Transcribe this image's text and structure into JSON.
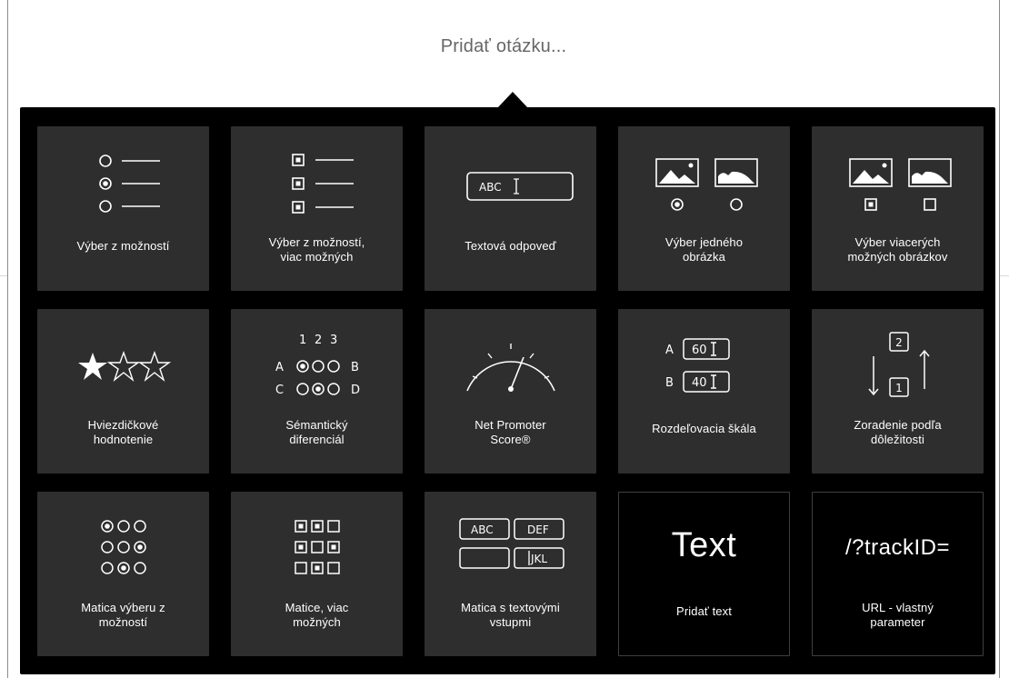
{
  "header": {
    "add_question_label": "Pridať otázku..."
  },
  "tiles": [
    {
      "id": "single-choice",
      "label_lines": [
        "Výber z možností"
      ],
      "icon": "radio-list-icon"
    },
    {
      "id": "multiple-choice",
      "label_lines": [
        "Výber z možností,",
        "viac možných"
      ],
      "icon": "checkbox-list-icon"
    },
    {
      "id": "text-answer",
      "label_lines": [
        "Textová odpoveď"
      ],
      "icon": "text-field-icon",
      "icon_text": "ABC"
    },
    {
      "id": "single-image",
      "label_lines": [
        "Výber jedného",
        "obrázka"
      ],
      "icon": "image-radio-icon"
    },
    {
      "id": "multiple-image",
      "label_lines": [
        "Výber viacerých",
        "možných obrázkov"
      ],
      "icon": "image-checkbox-icon"
    },
    {
      "id": "star-rating",
      "label_lines": [
        "Hviezdičkové",
        "hodnotenie"
      ],
      "icon": "star-rating-icon"
    },
    {
      "id": "semantic-differential",
      "label_lines": [
        "Sémantický",
        "diferenciál"
      ],
      "icon": "semantic-differential-icon",
      "icon_text": {
        "numbers": [
          "1",
          "2",
          "3"
        ],
        "rows": [
          "A",
          "B",
          "C",
          "D"
        ]
      }
    },
    {
      "id": "nps",
      "label_lines": [
        "Net Promoter",
        "Score®"
      ],
      "icon": "gauge-icon"
    },
    {
      "id": "constant-sum",
      "label_lines": [
        "Rozdeľovacia škála"
      ],
      "icon": "split-scale-icon",
      "icon_text": {
        "row_a": "A",
        "row_b": "B",
        "val_a": "60",
        "val_b": "40"
      }
    },
    {
      "id": "ranking",
      "label_lines": [
        "Zoradenie podľa",
        "dôležitosti"
      ],
      "icon": "ranking-icon",
      "icon_text": {
        "top": "2",
        "bottom": "1"
      }
    },
    {
      "id": "radio-matrix",
      "label_lines": [
        "Matica výberu z",
        "možností"
      ],
      "icon": "radio-matrix-icon"
    },
    {
      "id": "checkbox-matrix",
      "label_lines": [
        "Matice, viac",
        "možných"
      ],
      "icon": "checkbox-matrix-icon"
    },
    {
      "id": "text-matrix",
      "label_lines": [
        "Matica s textovými",
        "vstupmi"
      ],
      "icon": "text-matrix-icon",
      "icon_text": [
        "ABC",
        "DEF",
        "JKL"
      ]
    },
    {
      "id": "add-text",
      "label_lines": [
        "Pridať text"
      ],
      "big_text": "Text"
    },
    {
      "id": "url-parameter",
      "label_lines": [
        "URL - vlastný",
        "parameter"
      ],
      "big_text": "/?trackID="
    }
  ]
}
